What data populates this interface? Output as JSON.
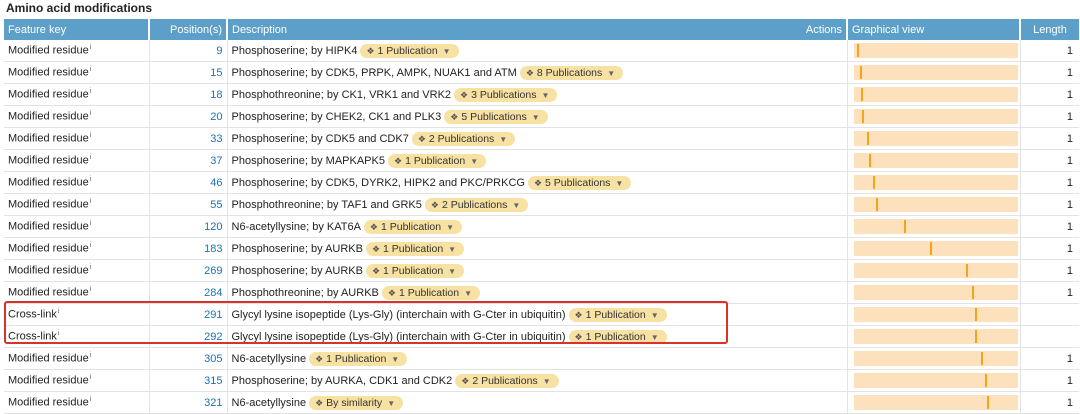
{
  "section_title": "Amino acid modifications",
  "headers": {
    "feature_key": "Feature key",
    "positions": "Position(s)",
    "description": "Description",
    "actions": "Actions",
    "graphical_view": "Graphical view",
    "length": "Length"
  },
  "protein_length": 393,
  "rows": [
    {
      "key": "Modified residue",
      "pos": 9,
      "desc": "Phosphoserine; by HIPK4",
      "pub": "1 Publication",
      "len": "1"
    },
    {
      "key": "Modified residue",
      "pos": 15,
      "desc": "Phosphoserine; by CDK5, PRPK, AMPK, NUAK1 and ATM",
      "pub": "8 Publications",
      "len": "1"
    },
    {
      "key": "Modified residue",
      "pos": 18,
      "desc": "Phosphothreonine; by CK1, VRK1 and VRK2",
      "pub": "3 Publications",
      "len": "1"
    },
    {
      "key": "Modified residue",
      "pos": 20,
      "desc": "Phosphoserine; by CHEK2, CK1 and PLK3",
      "pub": "5 Publications",
      "len": "1"
    },
    {
      "key": "Modified residue",
      "pos": 33,
      "desc": "Phosphoserine; by CDK5 and CDK7",
      "pub": "2 Publications",
      "len": "1"
    },
    {
      "key": "Modified residue",
      "pos": 37,
      "desc": "Phosphoserine; by MAPKAPK5",
      "pub": "1 Publication",
      "len": "1"
    },
    {
      "key": "Modified residue",
      "pos": 46,
      "desc": "Phosphoserine; by CDK5, DYRK2, HIPK2 and PKC/PRKCG",
      "pub": "5 Publications",
      "len": "1"
    },
    {
      "key": "Modified residue",
      "pos": 55,
      "desc": "Phosphothreonine; by TAF1 and GRK5",
      "pub": "2 Publications",
      "len": "1"
    },
    {
      "key": "Modified residue",
      "pos": 120,
      "desc": "N6-acetyllysine; by KAT6A",
      "pub": "1 Publication",
      "len": "1"
    },
    {
      "key": "Modified residue",
      "pos": 183,
      "desc": "Phosphoserine; by AURKB",
      "pub": "1 Publication",
      "len": "1"
    },
    {
      "key": "Modified residue",
      "pos": 269,
      "desc": "Phosphoserine; by AURKB",
      "pub": "1 Publication",
      "len": "1"
    },
    {
      "key": "Modified residue",
      "pos": 284,
      "desc": "Phosphothreonine; by AURKB",
      "pub": "1 Publication",
      "len": "1"
    },
    {
      "key": "Cross-link",
      "pos": 291,
      "desc": "Glycyl lysine isopeptide (Lys-Gly) (interchain with G-Cter in ubiquitin)",
      "pub": "1 Publication",
      "len": ""
    },
    {
      "key": "Cross-link",
      "pos": 292,
      "desc": "Glycyl lysine isopeptide (Lys-Gly) (interchain with G-Cter in ubiquitin)",
      "pub": "1 Publication",
      "len": ""
    },
    {
      "key": "Modified residue",
      "pos": 305,
      "desc": "N6-acetyllysine",
      "pub": "1 Publication",
      "len": "1"
    },
    {
      "key": "Modified residue",
      "pos": 315,
      "desc": "Phosphoserine; by AURKA, CDK1 and CDK2",
      "pub": "2 Publications",
      "len": "1"
    },
    {
      "key": "Modified residue",
      "pos": 321,
      "desc": "N6-acetyllysine",
      "pub": "By similarity",
      "len": "1"
    }
  ]
}
